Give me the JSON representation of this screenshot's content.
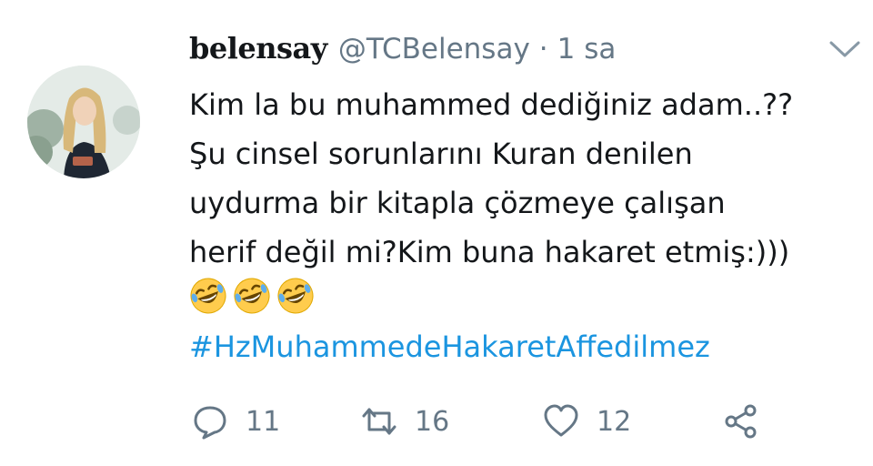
{
  "tweet": {
    "display_name": "belensay",
    "handle": "@TCBelensay",
    "separator": "·",
    "time": "1 sa",
    "text_lines": [
      "Kim la bu muhammed dediğiniz adam..??",
      "Şu cinsel sorunlarını Kuran denilen",
      "uydurma bir kitapla çözmeye çalışan",
      "herif değil mi?Kim buna hakaret etmiş:)))"
    ],
    "emojis": [
      "rolling-on-floor-laughing",
      "rolling-on-floor-laughing",
      "rolling-on-floor-laughing"
    ],
    "hashtag": "#HzMuhammedeHakaretAffedilmez"
  },
  "actions": {
    "replies": "11",
    "retweets": "16",
    "likes": "12"
  },
  "colors": {
    "hashtag": "#1b95e0",
    "muted": "#657786",
    "text": "#14171a"
  }
}
